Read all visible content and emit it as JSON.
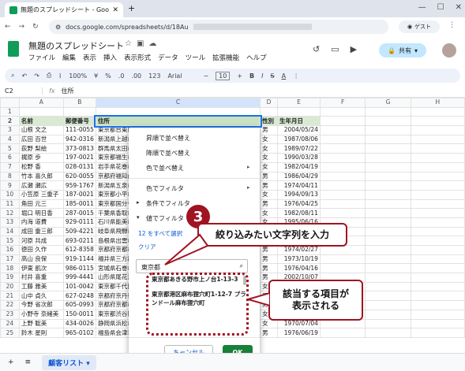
{
  "browser": {
    "tab_title": "無題のスプレッドシート - Google スプ",
    "url": "docs.google.com/spreadsheets/d/18Au",
    "guest": "ゲスト"
  },
  "app": {
    "doc_title": "無題のスプレッドシート",
    "menus": [
      "ファイル",
      "編集",
      "表示",
      "挿入",
      "表示形式",
      "データ",
      "ツール",
      "拡張機能",
      "ヘルプ"
    ],
    "share": "共有"
  },
  "toolbar": {
    "zoom": "100%",
    "currency": "¥",
    "percent": "%",
    "dec1": ".0",
    "dec2": ".00",
    "num": "123",
    "font": "Arial",
    "size": "10",
    "minus": "−",
    "plus": "+",
    "bold": "B",
    "italic": "I",
    "strike": "S",
    "color": "A"
  },
  "formula": {
    "cell": "C2",
    "fx": "fx",
    "value": "住所"
  },
  "sheet": {
    "cols": [
      "",
      "A",
      "B",
      "C",
      "D",
      "E",
      "F",
      "G",
      "H"
    ],
    "header": [
      "名前",
      "郵便番号",
      "住所",
      "性別",
      "生年月日"
    ],
    "rows": [
      [
        "山根 文之",
        "111-0055",
        "東京都台東区",
        "男",
        "2004/05/24"
      ],
      [
        "広田 百世",
        "942-0316",
        "新潟県上越市",
        "女",
        "1987/08/06"
      ],
      [
        "荻野 梨絵",
        "373-0813",
        "群馬県太田市",
        "女",
        "1989/07/22"
      ],
      [
        "梶原 歩",
        "197-0021",
        "東京都福生市",
        "女",
        "1990/03/28"
      ],
      [
        "松野 香",
        "028-0131",
        "岩手県花巻市",
        "女",
        "1982/04/19"
      ],
      [
        "竹本 喜久郎",
        "620-0055",
        "京都府福知山市",
        "男",
        "1986/04/29"
      ],
      [
        "広瀬 瀬広",
        "959-1767",
        "新潟県五泉市",
        "男",
        "1974/04/11"
      ],
      [
        "小笠原 三重子",
        "187-0021",
        "東京都小平市",
        "女",
        "1994/09/13"
      ],
      [
        "角田 元三",
        "185-0011",
        "東京都国分寺市",
        "男",
        "1976/04/25"
      ],
      [
        "堀口 明日香",
        "287-0015",
        "千葉県香取市",
        "女",
        "1982/08/11"
      ],
      [
        "内海 道費",
        "929-0111",
        "石川県能美市",
        "女",
        "1995/06/16"
      ],
      [
        "成田 重三郎",
        "509-4221",
        "岐阜県飛騨市",
        "男",
        "1976/09/05"
      ],
      [
        "河原 共成",
        "693-0211",
        "島根県出雲市",
        "男",
        "1993/10/24"
      ],
      [
        "徳田 久作",
        "612-8358",
        "京都府京都市",
        "男",
        "1974/02/27"
      ],
      [
        "高山 良保",
        "919-1144",
        "福井県三方郡",
        "男",
        "1973/10/19"
      ],
      [
        "伊東 凱次",
        "986-0115",
        "宮城県石巻市",
        "男",
        "1976/04/16"
      ],
      [
        "村井 喜重",
        "999-4441",
        "山形県尾花沢市",
        "男",
        "2002/10/07"
      ],
      [
        "工藤 雅美",
        "101-0042",
        "東京都千代田区",
        "女",
        "1988/05/30"
      ],
      [
        "山中 貞久",
        "627-0248",
        "京都府京丹後市",
        "男",
        "1997/07/19"
      ],
      [
        "今野 省次郎",
        "605-0993",
        "京都府京都市",
        "男",
        "1987/10/05"
      ],
      [
        "小野寺 奈緒美",
        "150-0011",
        "東京都渋谷区",
        "女",
        "1996/10/25"
      ],
      [
        "上野 聡美",
        "434-0026",
        "静岡県浜松市",
        "女",
        "1970/07/04"
      ],
      [
        "鈴木 星則",
        "965-0102",
        "福島県会津若松市",
        "男",
        "1976/06/19"
      ]
    ]
  },
  "filter_menu": {
    "items": [
      "昇順で並べ替え",
      "降順で並べ替え",
      "色で並べ替え",
      "色でフィルタ",
      "条件でフィルタ",
      "値でフィルタ"
    ],
    "select_all": "12 をすべて選択",
    "clear": "クリア",
    "search_value": "東京都",
    "results": [
      "東京都あきる野市上ノ台1-13-3",
      "東京都港区麻布狸穴町1-12-7 プランドール麻布狸穴町"
    ],
    "cancel": "キャンセル",
    "ok": "OK"
  },
  "annotations": {
    "step": "3",
    "callout1": "絞り込みたい文字列を入力",
    "callout2": "該当する項目が\n表示される"
  },
  "bottom": {
    "add": "+",
    "list": "≡",
    "sheet_tab": "顧客リスト",
    "tab_arrow": "▾"
  }
}
